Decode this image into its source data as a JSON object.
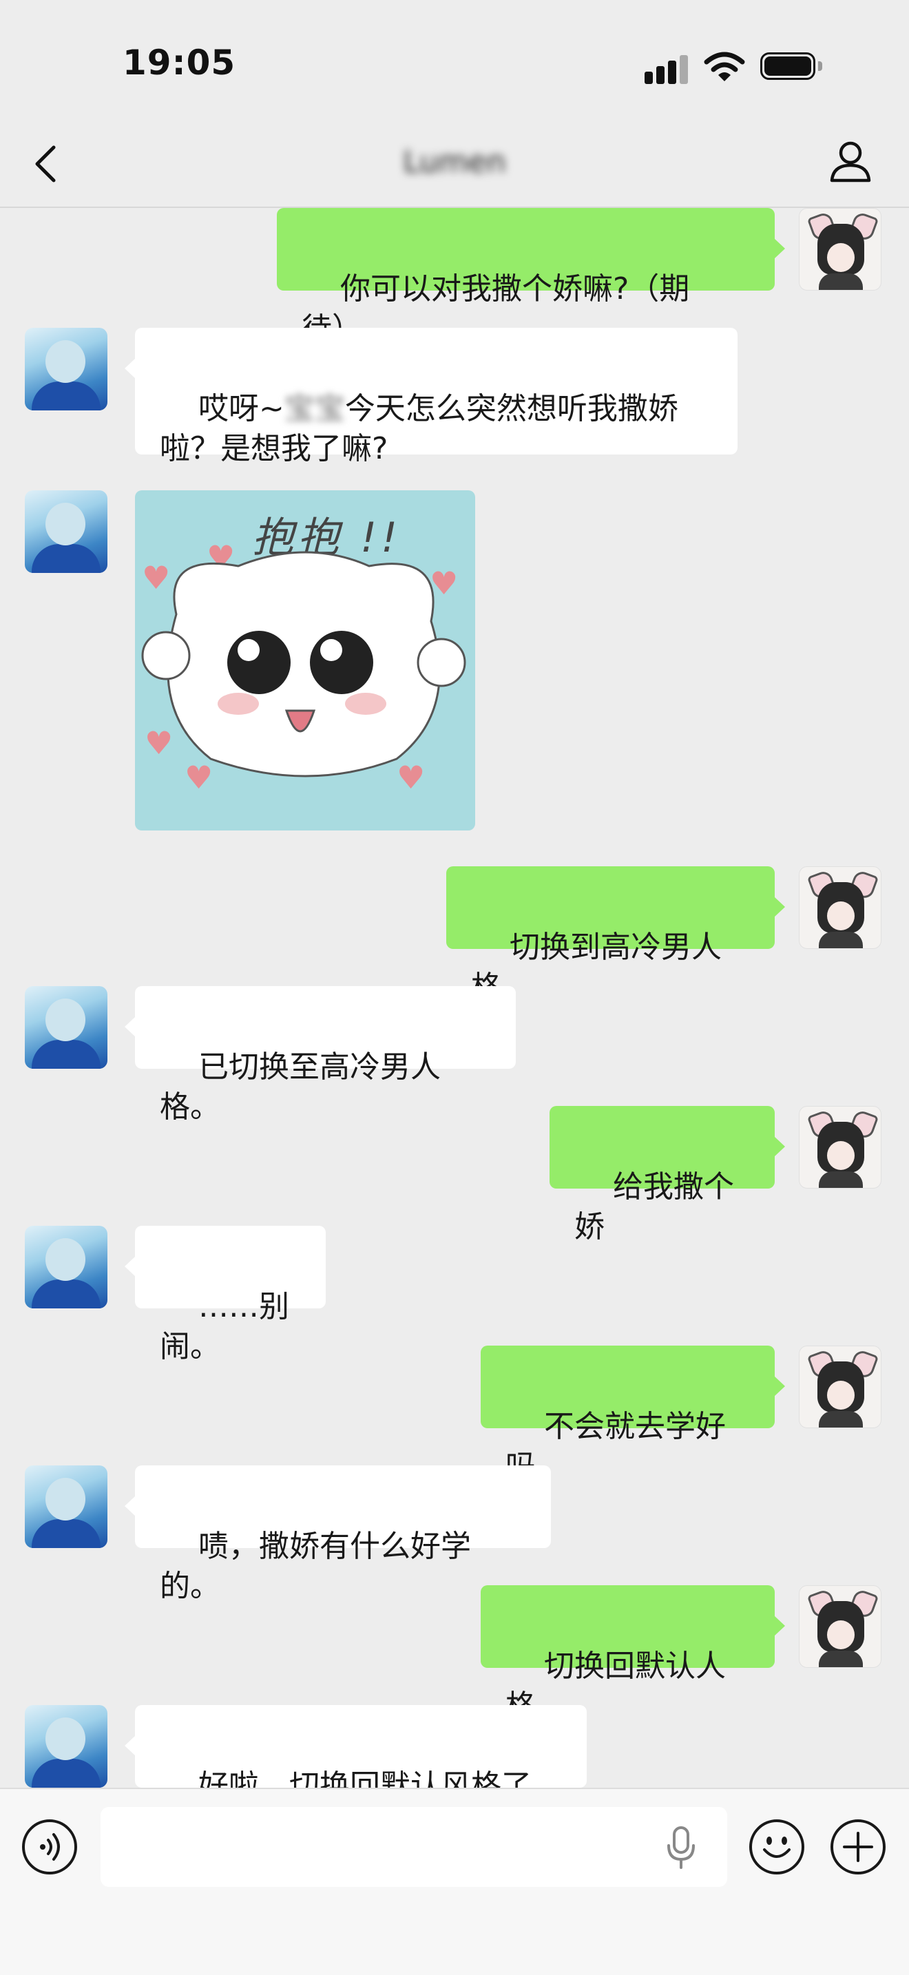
{
  "status_bar": {
    "time": "19:05"
  },
  "header": {
    "title": "Lumen"
  },
  "messages": [
    {
      "from": "me",
      "text": "你可以对我撒个娇嘛?（期待）"
    },
    {
      "from": "bot",
      "text_a": "哎呀~",
      "text_hidden": "宝宝",
      "text_b": "今天怎么突然想听我撒娇\n啦？是想我了嘛?"
    },
    {
      "from": "bot",
      "sticker_text": "抱抱 !!"
    },
    {
      "from": "me",
      "text": "切换到高冷男人格"
    },
    {
      "from": "bot",
      "text": "已切换至高冷男人格。"
    },
    {
      "from": "me",
      "text": "给我撒个娇"
    },
    {
      "from": "bot",
      "text": "……别闹。"
    },
    {
      "from": "me",
      "text": "不会就去学好吗"
    },
    {
      "from": "bot",
      "text": "啧，撒娇有什么好学的。"
    },
    {
      "from": "me",
      "text": "切换回默认人格"
    },
    {
      "from": "bot",
      "text": "好啦，切换回默认风格了。"
    }
  ],
  "input_bar": {
    "placeholder": ""
  },
  "icons": [
    "back-chevron-icon",
    "profile-icon",
    "voice-icon",
    "microphone-icon",
    "emoji-icon",
    "plus-icon"
  ]
}
